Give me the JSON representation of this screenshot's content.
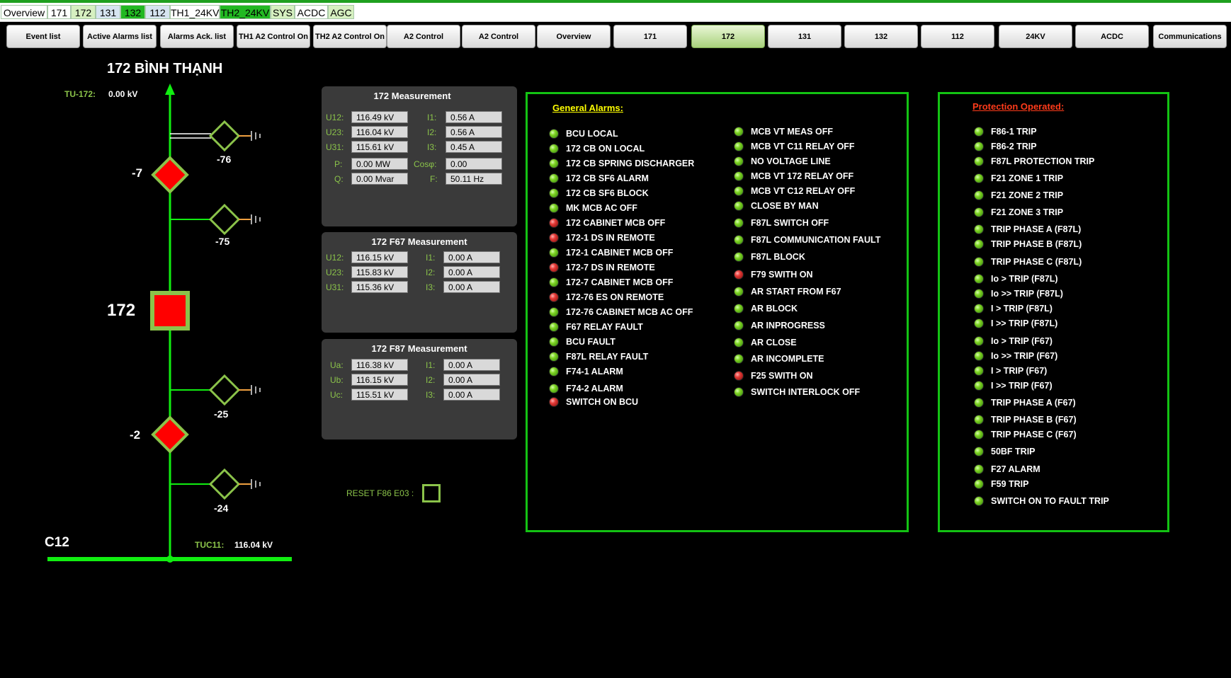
{
  "tabs": [
    {
      "label": "Overview",
      "bg": "#ffffff"
    },
    {
      "label": "171",
      "bg": "#ffffff"
    },
    {
      "label": "172",
      "bg": "#d6f0c0"
    },
    {
      "label": "131",
      "bg": "#d6e4f0"
    },
    {
      "label": "132",
      "bg": "#22b822"
    },
    {
      "label": "112",
      "bg": "#d6e4f0"
    },
    {
      "label": "TH1_24KV",
      "bg": "#ffffff"
    },
    {
      "label": "TH2_24KV",
      "bg": "#22b822"
    },
    {
      "label": "SYS",
      "bg": "#d6f0c0"
    },
    {
      "label": "ACDC",
      "bg": "#ffffff"
    },
    {
      "label": "AGC",
      "bg": "#d6f0c0"
    }
  ],
  "nav_buttons": [
    {
      "label": "Event list",
      "active": false
    },
    {
      "label": "Active Alarms list",
      "active": false
    },
    {
      "label": "Alarms Ack. list",
      "active": false
    },
    {
      "label": "TH1 A2 Control On",
      "active": false
    },
    {
      "label": "TH2 A2 Control On",
      "active": false
    },
    {
      "label": "A2 Control",
      "active": false
    },
    {
      "label": "A2 Control",
      "active": false
    },
    {
      "label": "Overview",
      "active": false
    },
    {
      "label": "171",
      "active": false
    },
    {
      "label": "172",
      "active": true
    },
    {
      "label": "131",
      "active": false
    },
    {
      "label": "132",
      "active": false
    },
    {
      "label": "112",
      "active": false
    },
    {
      "label": "24KV",
      "active": false
    },
    {
      "label": "ACDC",
      "active": false
    },
    {
      "label": "Communications",
      "active": false
    }
  ],
  "diagram": {
    "title": "172 BÌNH THẠNH",
    "tu_label": "TU-172:",
    "tu_value": "0.00 kV",
    "breaker_label": "172",
    "ds_top_label": "-7",
    "ds_bottom_label": "-2",
    "es_76": "-76",
    "es_75": "-75",
    "es_25": "-25",
    "es_24": "-24",
    "bus_label": "C12",
    "tuc_label": "TUC11:",
    "tuc_value": "116.04 kV",
    "colors": {
      "line": "#11ee11",
      "device": "#8bc34a",
      "closed": "#ff0000"
    }
  },
  "measure_172": {
    "title": "172 Measurement",
    "labels": [
      "U12:",
      "U23:",
      "U31:",
      "I1:",
      "I2:",
      "I3:",
      "P:",
      "Q:",
      "Cosφ:",
      "F:"
    ],
    "values": [
      "116.49 kV",
      "116.04 kV",
      "115.61 kV",
      "0.56 A",
      "0.56 A",
      "0.45 A",
      "0.00 MW",
      "0.00 Mvar",
      "0.00",
      "50.11 Hz"
    ]
  },
  "measure_f67": {
    "title": "172 F67  Measurement",
    "labels": [
      "U12:",
      "U23:",
      "U31:",
      "I1:",
      "I2:",
      "I3:"
    ],
    "values": [
      "116.15 kV",
      "115.83 kV",
      "115.36 kV",
      "0.00 A",
      "0.00 A",
      "0.00 A"
    ]
  },
  "measure_f87": {
    "title": "172 F87 Measurement",
    "labels": [
      "Ua:",
      "Ub:",
      "Uc:",
      "I1:",
      "I2:",
      "I3:"
    ],
    "values": [
      "116.38 kV",
      "116.15 kV",
      "115.51 kV",
      "0.00 A",
      "0.00 A",
      "0.00 A"
    ]
  },
  "reset_label": "RESET F86 E03 :",
  "general_alarms": {
    "title": "General Alarms:",
    "title_color": "#ffff00",
    "col1": [
      {
        "label": "BCU LOCAL",
        "state": "green"
      },
      {
        "label": "172 CB ON LOCAL",
        "state": "green"
      },
      {
        "label": "172 CB SPRING DISCHARGER",
        "state": "green"
      },
      {
        "label": "172 CB SF6 ALARM",
        "state": "green"
      },
      {
        "label": "172 CB SF6 BLOCK",
        "state": "green"
      },
      {
        "label": "MK MCB AC OFF",
        "state": "green"
      },
      {
        "label": "172 CABINET MCB OFF",
        "state": "red"
      },
      {
        "label": "172-1 DS IN REMOTE",
        "state": "red"
      },
      {
        "label": "172-1 CABINET MCB OFF",
        "state": "green"
      },
      {
        "label": "172-7 DS IN REMOTE",
        "state": "red"
      },
      {
        "label": "172-7 CABINET MCB OFF",
        "state": "green"
      },
      {
        "label": "172-76 ES ON REMOTE",
        "state": "red"
      },
      {
        "label": "172-76 CABINET MCB AC OFF",
        "state": "green"
      },
      {
        "label": "F67 RELAY FAULT",
        "state": "green"
      },
      {
        "label": "BCU FAULT",
        "state": "green"
      },
      {
        "label": "F87L RELAY FAULT",
        "state": "green"
      },
      {
        "label": "F74-1 ALARM",
        "state": "green"
      },
      {
        "label": "F74-2 ALARM",
        "state": "green"
      },
      {
        "label": "SWITCH ON BCU",
        "state": "red"
      }
    ],
    "col2": [
      {
        "label": "MCB VT MEAS OFF",
        "state": "green"
      },
      {
        "label": "MCB VT C11 RELAY OFF",
        "state": "green"
      },
      {
        "label": "NO VOLTAGE LINE",
        "state": "green"
      },
      {
        "label": "MCB VT 172 RELAY OFF",
        "state": "green"
      },
      {
        "label": "MCB VT C12 RELAY OFF",
        "state": "green"
      },
      {
        "label": "CLOSE BY MAN",
        "state": "green"
      },
      {
        "label": "F87L SWITCH OFF",
        "state": "green"
      },
      {
        "label": "F87L COMMUNICATION FAULT",
        "state": "green"
      },
      {
        "label": "F87L BLOCK",
        "state": "green"
      },
      {
        "label": "F79 SWITH ON",
        "state": "red"
      },
      {
        "label": "AR START FROM F67",
        "state": "green"
      },
      {
        "label": "AR BLOCK",
        "state": "green"
      },
      {
        "label": "AR INPROGRESS",
        "state": "green"
      },
      {
        "label": "AR CLOSE",
        "state": "green"
      },
      {
        "label": "AR INCOMPLETE",
        "state": "green"
      },
      {
        "label": "F25 SWITH ON",
        "state": "red"
      },
      {
        "label": "SWITCH INTERLOCK OFF",
        "state": "green"
      }
    ]
  },
  "protection": {
    "title": "Protection Operated:",
    "title_color": "#ff3b1a",
    "items": [
      {
        "label": "F86-1 TRIP",
        "state": "green"
      },
      {
        "label": "F86-2 TRIP",
        "state": "green"
      },
      {
        "label": "F87L PROTECTION TRIP",
        "state": "green"
      },
      {
        "label": "F21 ZONE 1 TRIP",
        "state": "green"
      },
      {
        "label": "F21 ZONE 2 TRIP",
        "state": "green"
      },
      {
        "label": "F21 ZONE 3 TRIP",
        "state": "green"
      },
      {
        "label": "TRIP PHASE A (F87L)",
        "state": "green"
      },
      {
        "label": "TRIP PHASE B (F87L)",
        "state": "green"
      },
      {
        "label": "TRIP PHASE C (F87L)",
        "state": "green"
      },
      {
        "label": "Io > TRIP (F87L)",
        "state": "green"
      },
      {
        "label": "Io >> TRIP (F87L)",
        "state": "green"
      },
      {
        "label": "I > TRIP (F87L)",
        "state": "green"
      },
      {
        "label": "I >> TRIP (F87L)",
        "state": "green"
      },
      {
        "label": "Io > TRIP (F67)",
        "state": "green"
      },
      {
        "label": "Io >> TRIP (F67)",
        "state": "green"
      },
      {
        "label": "I > TRIP (F67)",
        "state": "green"
      },
      {
        "label": "I >> TRIP (F67)",
        "state": "green"
      },
      {
        "label": "TRIP PHASE A (F67)",
        "state": "green"
      },
      {
        "label": "TRIP PHASE B (F67)",
        "state": "green"
      },
      {
        "label": "TRIP PHASE C (F67)",
        "state": "green"
      },
      {
        "label": "50BF TRIP",
        "state": "green"
      },
      {
        "label": "F27 ALARM",
        "state": "green"
      },
      {
        "label": "F59 TRIP",
        "state": "green"
      },
      {
        "label": "SWITCH ON TO FAULT TRIP",
        "state": "green"
      }
    ]
  }
}
